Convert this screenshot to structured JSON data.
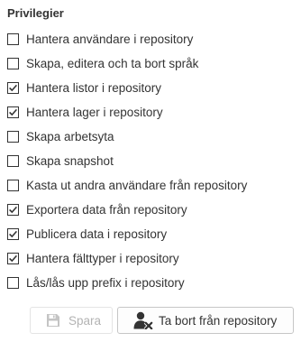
{
  "privileges": {
    "title": "Privilegier",
    "items": [
      {
        "label": "Hantera användare i repository",
        "checked": false
      },
      {
        "label": "Skapa, editera och ta bort språk",
        "checked": false
      },
      {
        "label": "Hantera listor i repository",
        "checked": true
      },
      {
        "label": "Hantera lager i repository",
        "checked": true
      },
      {
        "label": "Skapa arbetsyta",
        "checked": false
      },
      {
        "label": "Skapa snapshot",
        "checked": false
      },
      {
        "label": "Kasta ut andra användare från repository",
        "checked": false
      },
      {
        "label": "Exportera data från repository",
        "checked": true
      },
      {
        "label": "Publicera data i repository",
        "checked": true
      },
      {
        "label": "Hantera fälttyper i repository",
        "checked": true
      },
      {
        "label": "Lås/lås upp prefix i repository",
        "checked": false
      }
    ]
  },
  "actions": {
    "save_label": "Spara",
    "save_icon": "floppy-disk-icon",
    "save_disabled": true,
    "delete_label": "Ta bort från repository",
    "delete_icon": "remove-user-icon"
  },
  "colors": {
    "text": "#333333",
    "disabled_text": "#b3b3b3",
    "checkbox_border": "#333333"
  }
}
